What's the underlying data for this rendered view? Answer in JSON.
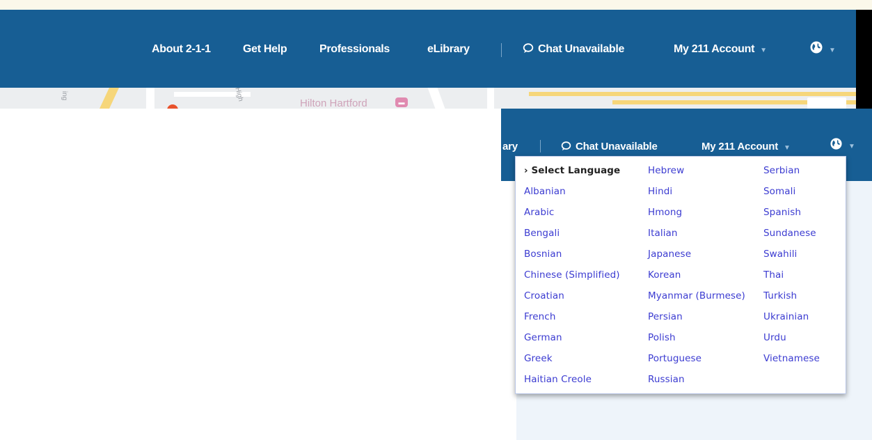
{
  "nav": {
    "items": [
      {
        "label": "About 2-1-1"
      },
      {
        "label": "Get Help"
      },
      {
        "label": "Professionals"
      },
      {
        "label": "eLibrary"
      }
    ],
    "chat_label": "Chat Unavailable",
    "account_label": "My 211 Account"
  },
  "map": {
    "hotel_label": "Hilton Hartford",
    "street_label_1": "High",
    "street_label_2": "ing"
  },
  "zoom_bar": {
    "partial_label": "ary",
    "chat_label": "Chat Unavailable",
    "account_label": "My 211 Account"
  },
  "language_menu": {
    "columns": [
      [
        "› Select Language",
        "Albanian",
        "Arabic",
        "Bengali",
        "Bosnian",
        "Chinese (Simplified)",
        "Croatian",
        "French",
        "German",
        "Greek",
        "Haitian Creole"
      ],
      [
        "Hebrew",
        "Hindi",
        "Hmong",
        "Italian",
        "Japanese",
        "Korean",
        "Myanmar (Burmese)",
        "Persian",
        "Polish",
        "Portuguese",
        "Russian"
      ],
      [
        "Serbian",
        "Somali",
        "Spanish",
        "Sundanese",
        "Swahili",
        "Thai",
        "Turkish",
        "Ukrainian",
        "Urdu",
        "Vietnamese"
      ]
    ]
  },
  "colors": {
    "nav_bg": "#175e94",
    "link": "#3b3bd1"
  }
}
